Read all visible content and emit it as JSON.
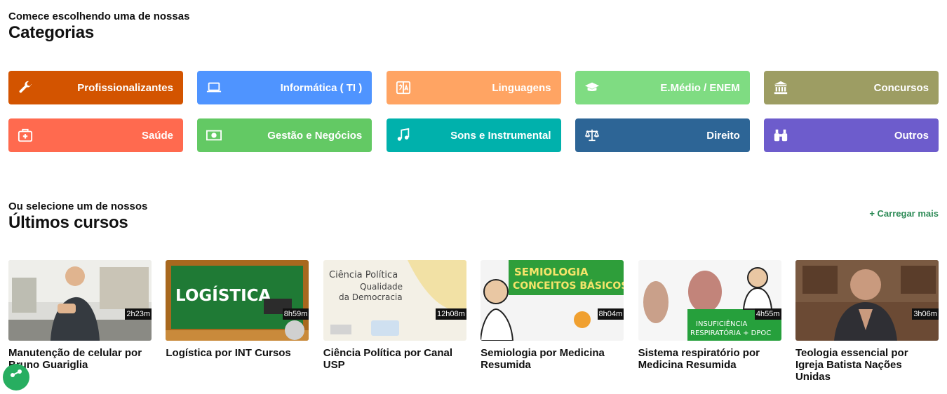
{
  "categories_section": {
    "eyebrow": "Comece escolhendo uma de nossas",
    "title": "Categorias"
  },
  "categories": [
    {
      "label": "Profissionalizantes",
      "icon": "wrench-icon",
      "color": "#d35400"
    },
    {
      "label": "Informática ( TI )",
      "icon": "laptop-icon",
      "color": "#4f94ff"
    },
    {
      "label": "Linguagens",
      "icon": "translate-icon",
      "color": "#ffa463"
    },
    {
      "label": "E.Médio / ENEM",
      "icon": "graduation-cap-icon",
      "color": "#7fdc82"
    },
    {
      "label": "Concursos",
      "icon": "institution-icon",
      "color": "#9d9d63"
    },
    {
      "label": "Saúde",
      "icon": "medkit-icon",
      "color": "#ff6a4f"
    },
    {
      "label": "Gestão e Negócios",
      "icon": "money-icon",
      "color": "#63c964"
    },
    {
      "label": "Sons e Instrumental",
      "icon": "music-icon",
      "color": "#00b1ac"
    },
    {
      "label": "Direito",
      "icon": "balance-scale-icon",
      "color": "#2d6596"
    },
    {
      "label": "Outros",
      "icon": "binoculars-icon",
      "color": "#6d5ccc"
    }
  ],
  "courses_section": {
    "eyebrow": "Ou selecione um de nossos",
    "title": "Últimos cursos",
    "load_more": "+ Carregar mais"
  },
  "courses": [
    {
      "title": "Manutenção de celular por Bruno Guariglia",
      "duration": "2h23m"
    },
    {
      "title": "Logística por INT Cursos",
      "duration": "8h59m",
      "thumb_text": "LOGÍSTICA"
    },
    {
      "title": "Ciência Política por Canal USP",
      "duration": "12h08m",
      "thumb_text": [
        "Ciência Política",
        "Qualidade",
        "da Democracia"
      ]
    },
    {
      "title": "Semiologia por Medicina Resumida",
      "duration": "8h04m",
      "thumb_text": [
        "SEMIOLOGIA",
        "CONCEITOS BÁSICOS"
      ]
    },
    {
      "title": "Sistema respiratório por Medicina Resumida",
      "duration": "4h55m",
      "thumb_text": [
        "INSUFICIÊNCIA",
        "RESPIRATÓRIA + DPOC"
      ]
    },
    {
      "title": "Teologia essencial por Igreja Batista Nações Unidas",
      "duration": "3h06m"
    }
  ]
}
